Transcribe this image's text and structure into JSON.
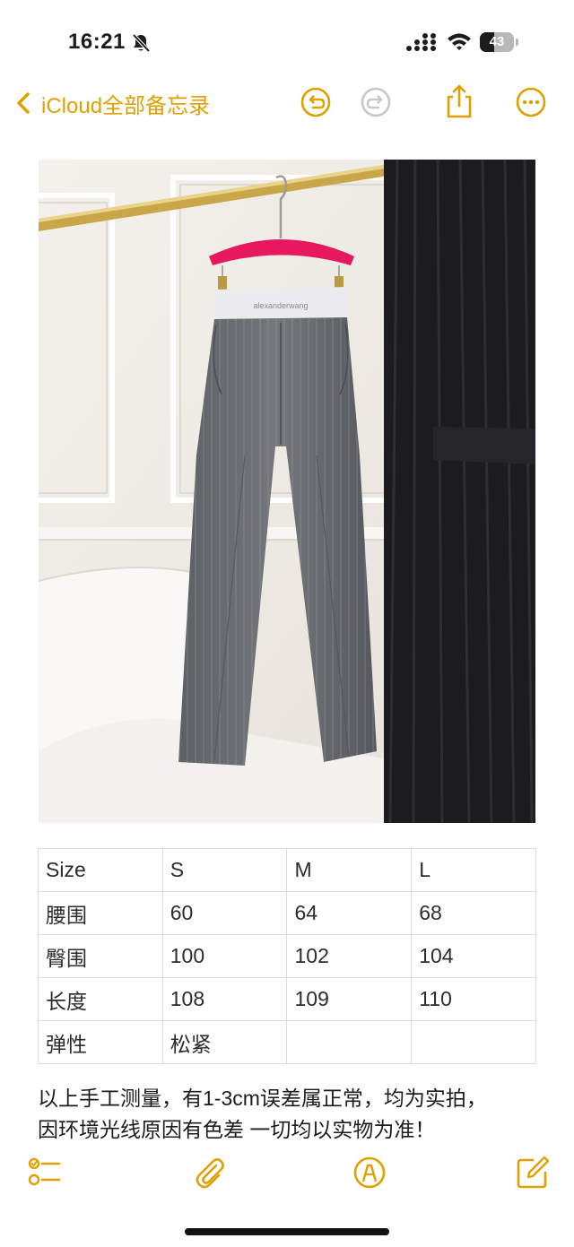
{
  "status_bar": {
    "time": "16:21",
    "battery_level": "43",
    "battery_fraction": 0.43,
    "icons": [
      "bell-slash-icon",
      "cellular-signal-icon",
      "wifi-icon",
      "battery-icon"
    ]
  },
  "nav": {
    "back_label": "iCloud全部备忘录",
    "icons": [
      "chevron-left-icon",
      "undo-icon",
      "redo-icon",
      "share-icon",
      "more-icon"
    ]
  },
  "photo": {
    "label_text": "alexanderwang",
    "description_icon": "photo-image"
  },
  "table": {
    "rows": [
      [
        "Size",
        "S",
        "M",
        "L"
      ],
      [
        "腰围",
        "60",
        "64",
        "68"
      ],
      [
        "臀围",
        "100",
        "102",
        "104"
      ],
      [
        "长度",
        "108",
        "109",
        "110"
      ],
      [
        "弹性",
        "松紧",
        "",
        ""
      ]
    ]
  },
  "note": {
    "line1": "以上手工测量，有1-3cm误差属正常，均为实拍，",
    "line2": "因环境光线原因有色差 一切均以实物为准！"
  },
  "toolbar": {
    "icons": [
      "checklist-icon",
      "paperclip-icon",
      "markup-pen-icon",
      "compose-icon"
    ]
  },
  "colors": {
    "accent": "#e0a100",
    "disabled": "#c7c7cc",
    "table_border": "#dcdcdc"
  }
}
